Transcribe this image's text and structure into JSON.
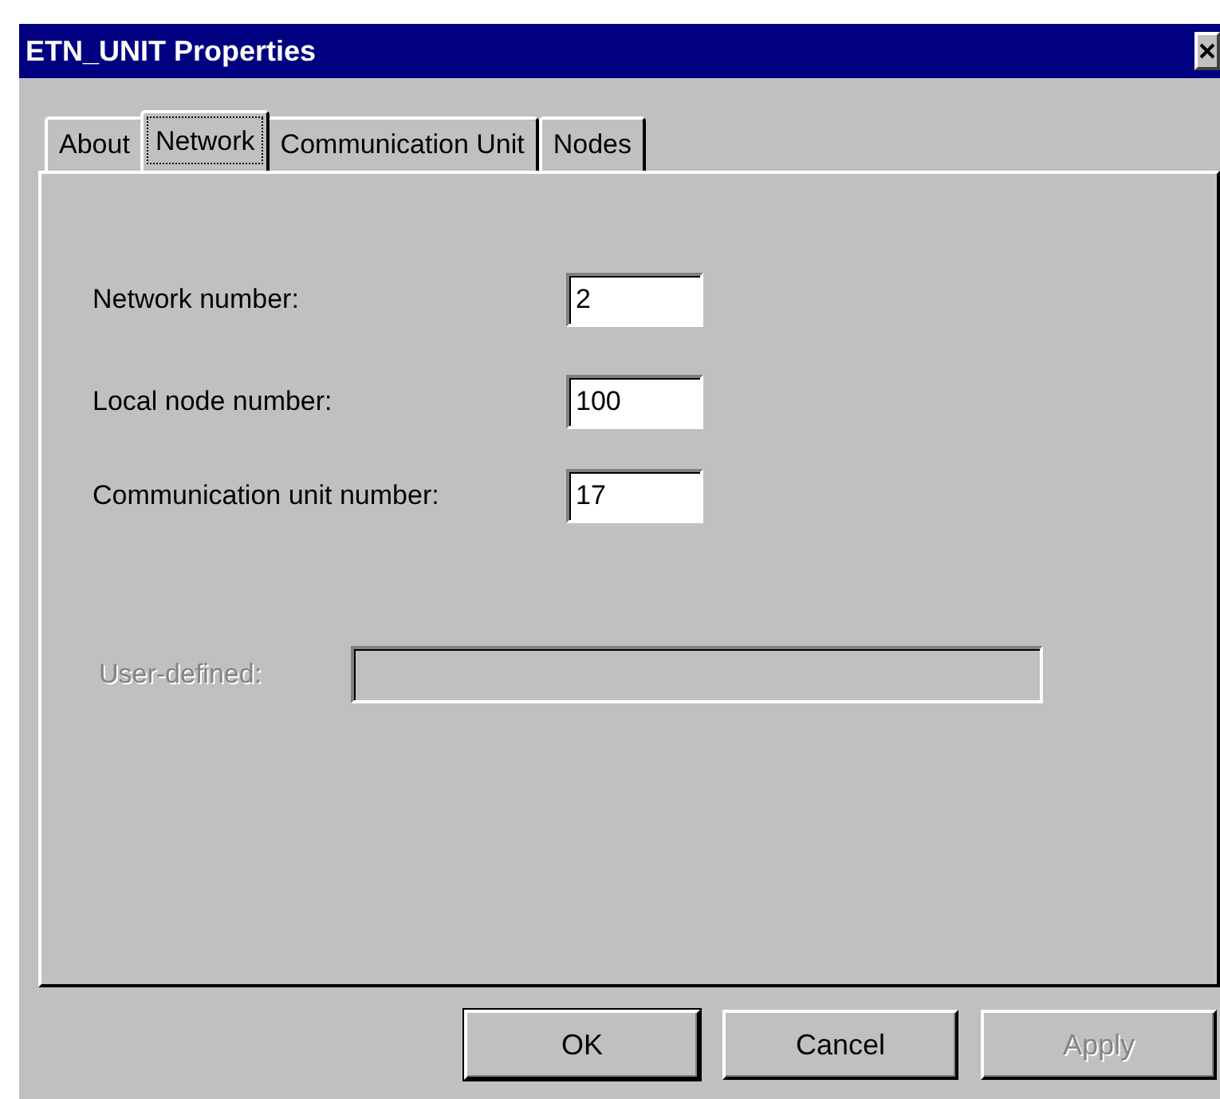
{
  "window": {
    "title": "ETN_UNIT Properties"
  },
  "tabs": [
    {
      "label": "About",
      "selected": false
    },
    {
      "label": "Network",
      "selected": true
    },
    {
      "label": "Communication Unit",
      "selected": false
    },
    {
      "label": "Nodes",
      "selected": false
    }
  ],
  "fields": [
    {
      "label": "Network number:",
      "value": "2",
      "disabled": false
    },
    {
      "label": "Local node number:",
      "value": "100",
      "disabled": false
    },
    {
      "label": "Communication unit number:",
      "value": "17",
      "disabled": false
    }
  ],
  "user_defined": {
    "label": "User-defined:",
    "disabled": true
  },
  "buttons": [
    {
      "label": "OK",
      "disabled": false
    },
    {
      "label": "Cancel",
      "disabled": false
    },
    {
      "label": "Apply",
      "disabled": true
    }
  ]
}
